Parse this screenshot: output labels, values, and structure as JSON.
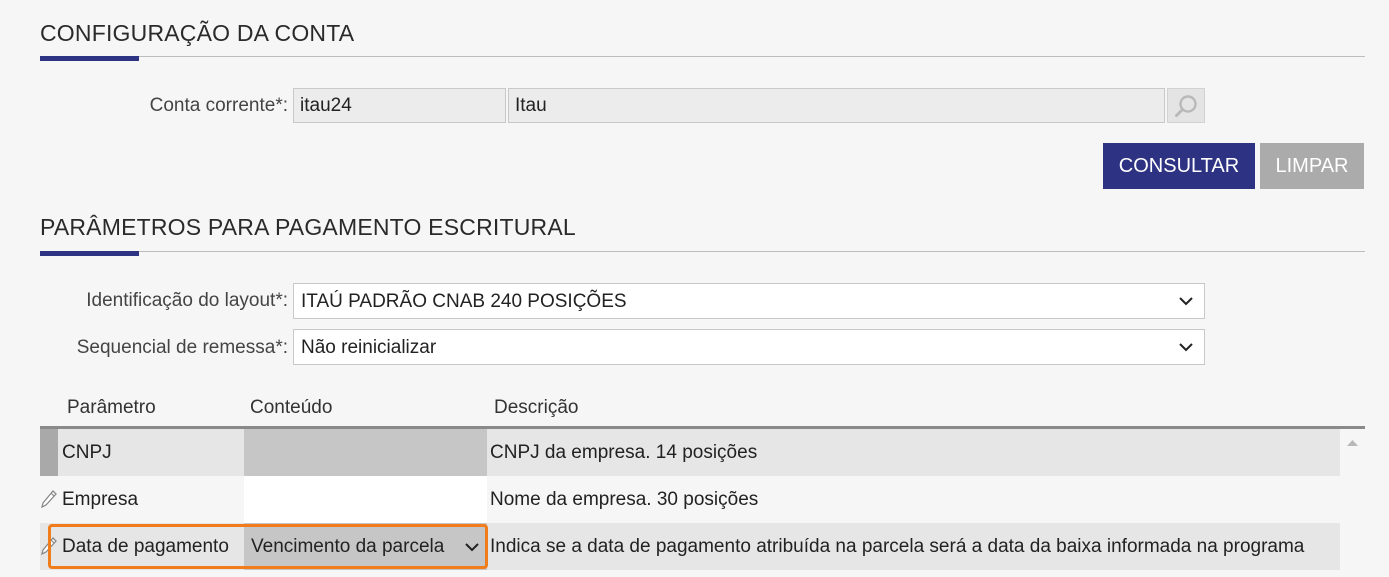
{
  "account_section": {
    "title": "CONFIGURAÇÃO DA CONTA",
    "account_label": "Conta corrente*:",
    "account_code": "itau24",
    "account_name": "Itau",
    "consult_label": "CONSULTAR",
    "clear_label": "LIMPAR"
  },
  "payment_section": {
    "title": "PARÂMETROS PARA PAGAMENTO ESCRITURAL",
    "layout_label": "Identificação do layout*:",
    "layout_value": "ITAÚ PADRÃO CNAB 240 POSIÇÕES",
    "sequence_label": "Sequencial de remessa*:",
    "sequence_value": "Não reinicializar"
  },
  "grid": {
    "columns": [
      "Parâmetro",
      "Conteúdo",
      "Descrição"
    ],
    "rows": [
      {
        "parameter": "CNPJ",
        "content": "",
        "description": "CNPJ da empresa. 14 posições"
      },
      {
        "parameter": "Empresa",
        "content": "",
        "description": "Nome da empresa. 30 posições"
      },
      {
        "parameter": "Data de pagamento",
        "content": "Vencimento da parcela",
        "description": "Indica se a data de pagamento atribuída na parcela será a data da baixa informada na programa"
      }
    ]
  },
  "colors": {
    "accent": "#2d3282",
    "highlight": "#f07c1b"
  }
}
